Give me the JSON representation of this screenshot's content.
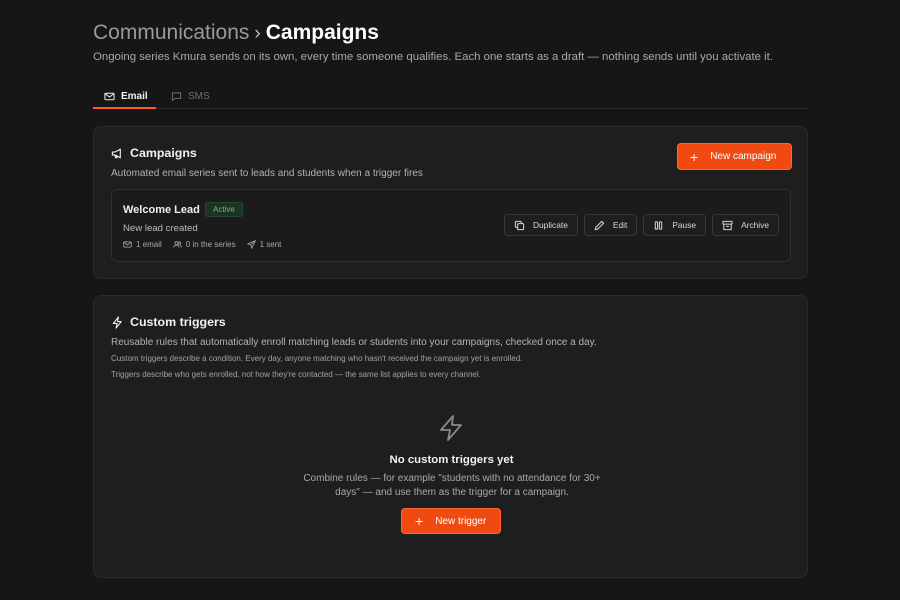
{
  "header": {
    "breadcrumb_parent": "Communications",
    "breadcrumb_separator": "›",
    "breadcrumb_current": "Campaigns",
    "subtitle": "Ongoing series Kmura sends on its own, every time someone qualifies. Each one starts as a draft — nothing sends until you activate it."
  },
  "tabs": [
    {
      "label": "Email",
      "icon": "mail-icon",
      "active": true
    },
    {
      "label": "SMS",
      "icon": "message-icon",
      "active": false
    }
  ],
  "campaigns": {
    "title": "Campaigns",
    "icon": "megaphone-icon",
    "description": "Automated email series sent to leads and students when a trigger fires",
    "new_button": "New campaign",
    "items": [
      {
        "name": "Welcome Lead",
        "status": "Active",
        "trigger": "New lead created",
        "meta": {
          "emails": "1 email",
          "in_series": "0 in the series",
          "sent": "1 sent"
        },
        "actions": {
          "duplicate": "Duplicate",
          "edit": "Edit",
          "pause": "Pause",
          "archive": "Archive"
        }
      }
    ]
  },
  "triggers": {
    "title": "Custom triggers",
    "icon": "lightning-icon",
    "description": "Reusable rules that automatically enroll matching leads or students into your campaigns, checked once a day.",
    "note_1": "Custom triggers describe a condition. Every day, anyone matching who hasn't received the campaign yet is enrolled.",
    "note_2": "Triggers describe who gets enrolled, not how they're contacted — the same list applies to every channel.",
    "empty_title": "No custom triggers yet",
    "empty_description": "Combine rules — for example \"students with no attendance for 30+ days\" — and use them as the trigger for a campaign.",
    "new_button": "New trigger"
  },
  "colors": {
    "background": "#161616",
    "card": "#1e1e1e",
    "accent": "#f04a12",
    "active_badge": "#58c07e"
  }
}
